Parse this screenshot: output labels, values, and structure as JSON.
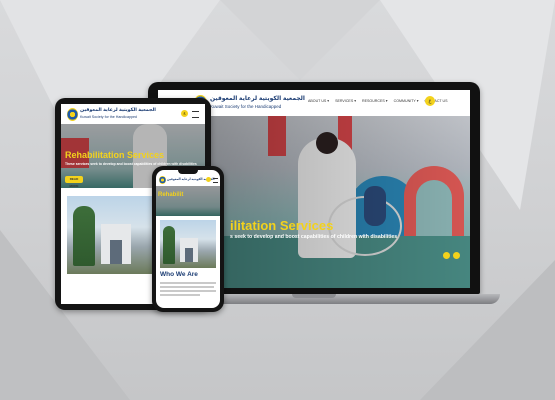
{
  "laptop": {
    "brand_arabic": "الجمعية الكويتية لرعاية المعوقين",
    "brand_english": "Kuwait Society for the Handicapped",
    "nav": [
      "ABOUT US ▾",
      "SERVICES ▾",
      "RESOURCES ▾",
      "COMMUNITY ▾",
      "CONTACT US"
    ],
    "lang_button": "ع",
    "hero_title": "ilitation Services",
    "hero_subtitle": "s seek to develop and boost capabilities of children with disabilities"
  },
  "tablet": {
    "brand_arabic": "الجمعية الكويتية لرعاية المعوقين",
    "brand_english": "Kuwait Society for the Handicapped",
    "lang_button": "ع",
    "hero_title": "Rehabilitation Services",
    "hero_subtitle": "These services seek to develop and boost capabilities of children with disabilities",
    "read_more": "READ MORE"
  },
  "phone": {
    "brand": "الجمعية الكويتية لرعاية المعوقين",
    "hero_title": "Rehabilit",
    "section_title": "Who We Are"
  },
  "colors": {
    "accent_yellow": "#f3d21c",
    "brand_navy": "#1b3c73",
    "device_black": "#141414"
  }
}
